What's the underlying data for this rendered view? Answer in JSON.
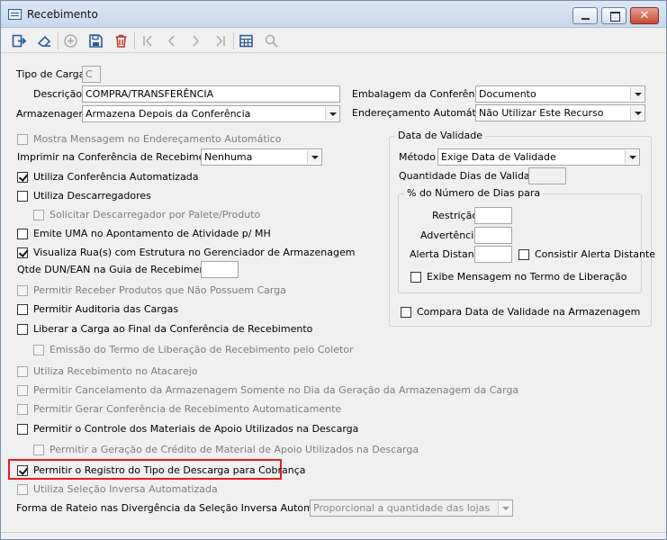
{
  "window": {
    "title": "Recebimento",
    "close_glyph": "✕"
  },
  "toolbar": {
    "buttons": [
      {
        "name": "exit-icon",
        "enabled": true
      },
      {
        "name": "eraser-icon",
        "enabled": true
      },
      {
        "name": "add-icon",
        "enabled": false
      },
      {
        "name": "save-icon",
        "enabled": true
      },
      {
        "name": "delete-icon",
        "enabled": true
      },
      {
        "name": "first-record-icon",
        "enabled": false
      },
      {
        "name": "previous-record-icon",
        "enabled": false
      },
      {
        "name": "next-record-icon",
        "enabled": false
      },
      {
        "name": "last-record-icon",
        "enabled": false
      },
      {
        "name": "grid-icon",
        "enabled": true
      },
      {
        "name": "search-icon",
        "enabled": false
      }
    ],
    "accent_blue": "#2d5c9a",
    "accent_red": "#c0392b"
  },
  "form": {
    "tipo_carga": {
      "label": "Tipo de Carga",
      "value": "C"
    },
    "descricao": {
      "label": "Descrição",
      "value": "COMPRA/TRANSFERÊNCIA"
    },
    "armazenagem": {
      "label": "Armazenagem",
      "value": "Armazena Depois da Conferência"
    },
    "embalagem": {
      "label": "Embalagem da Conferência",
      "value": "Documento"
    },
    "enderecamento": {
      "label": "Endereçamento Automático",
      "value": "Não Utilizar Este Recurso"
    },
    "imprimir": {
      "label": "Imprimir na Conferência de Recebimento",
      "value": "Nenhuma"
    },
    "qtde_dun": {
      "label": "Qtde DUN/EAN na Guia de Recebimento",
      "value": ""
    },
    "forma_rateio": {
      "label": "Forma de Rateio nas Divergência da Seleção Inversa Automatizada",
      "value": "Proporcional a quantidade das lojas"
    }
  },
  "checkboxes": {
    "mostra_msg": {
      "label": "Mostra Mensagem no Endereçamento Automático",
      "checked": false,
      "enabled": false
    },
    "utiliza_conf_auto": {
      "label": "Utiliza Conferência Automatizada",
      "checked": true,
      "enabled": true
    },
    "utiliza_descarregadores": {
      "label": "Utiliza Descarregadores",
      "checked": false,
      "enabled": true
    },
    "solicitar_descarregador": {
      "label": "Solicitar Descarregador por Palete/Produto",
      "checked": false,
      "enabled": false
    },
    "emite_uma": {
      "label": "Emite UMA no Apontamento de Atividade p/ MH",
      "checked": false,
      "enabled": true
    },
    "visualiza_ruas": {
      "label": "Visualiza Rua(s) com Estrutura no Gerenciador de Armazenagem",
      "checked": true,
      "enabled": true
    },
    "permitir_sem_carga": {
      "label": "Permitir Receber Produtos que Não Possuem Carga",
      "checked": false,
      "enabled": false
    },
    "permitir_auditoria": {
      "label": "Permitir Auditoria das Cargas",
      "checked": false,
      "enabled": true
    },
    "liberar_carga": {
      "label": "Liberar a Carga ao Final da Conferência de Recebimento",
      "checked": false,
      "enabled": true
    },
    "emissao_termo": {
      "label": "Emissão do Termo de Liberação de Recebimento pelo Coletor",
      "checked": false,
      "enabled": false
    },
    "utiliza_atacarejo": {
      "label": "Utiliza Recebimento no Atacarejo",
      "checked": false,
      "enabled": false
    },
    "permitir_cancelamento": {
      "label": "Permitir Cancelamento da Armazenagem Somente no Dia da Geração da Armazenagem da Carga",
      "checked": false,
      "enabled": false
    },
    "permitir_gerar_conf": {
      "label": "Permitir Gerar Conferência de Recebimento Automaticamente",
      "checked": false,
      "enabled": false
    },
    "permitir_controle": {
      "label": "Permitir o Controle dos Materiais de Apoio Utilizados na Descarga",
      "checked": false,
      "enabled": true
    },
    "permitir_credito": {
      "label": "Permitir a Geração de Crédito de Material de Apoio Utilizados na Descarga",
      "checked": false,
      "enabled": false
    },
    "permitir_registro": {
      "label": "Permitir o Registro do Tipo de Descarga para Cobrança",
      "checked": true,
      "enabled": true
    },
    "utiliza_selecao_inversa": {
      "label": "Utiliza Seleção Inversa Automatizada",
      "checked": false,
      "enabled": false
    }
  },
  "validade": {
    "group_title": "Data de Validade",
    "metodo": {
      "label": "Método",
      "value": "Exige Data de Validade"
    },
    "quantidade_dias": {
      "label": "Quantidade Dias de Validade",
      "value": ""
    },
    "percentual": {
      "group_title": "% do Número de Dias para",
      "restricao": {
        "label": "Restrição",
        "value": ""
      },
      "advertencia": {
        "label": "Advertência",
        "value": ""
      },
      "alerta_distante": {
        "label": "Alerta Distante",
        "value": ""
      },
      "consistir": {
        "label": "Consistir Alerta Distante",
        "checked": false
      },
      "exibe_msg": {
        "label": "Exibe Mensagem no Termo de Liberação",
        "checked": false
      }
    },
    "compara": {
      "label": "Compara Data de Validade na Armazenagem",
      "checked": false
    }
  }
}
